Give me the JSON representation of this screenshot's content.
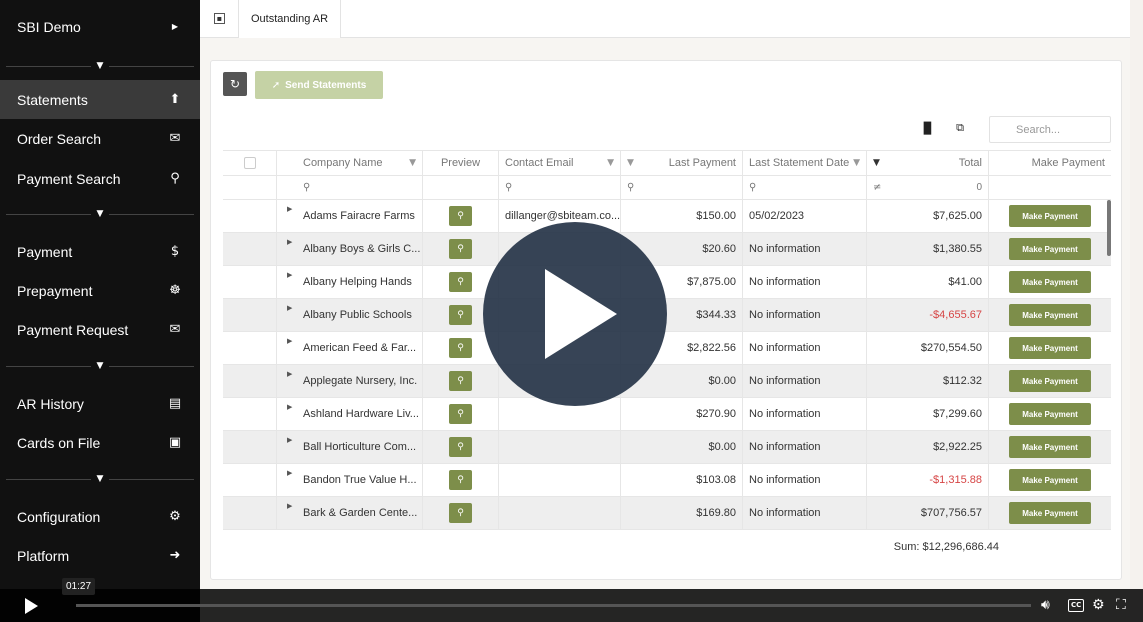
{
  "sidebar": {
    "title": "SBI Demo",
    "title_icon": "caret-right",
    "items": [
      {
        "label": "Statements",
        "icon": "upload-icon",
        "glyph": "⬆"
      },
      {
        "label": "Order Search",
        "icon": "envelope-open-icon",
        "glyph": "✉"
      },
      {
        "label": "Payment Search",
        "icon": "search-icon",
        "glyph": "⚲"
      },
      {
        "label": "Payment",
        "icon": "dollar-icon",
        "glyph": "$"
      },
      {
        "label": "Prepayment",
        "icon": "handshake-icon",
        "glyph": "☸"
      },
      {
        "label": "Payment Request",
        "icon": "envelope-icon",
        "glyph": "✉"
      },
      {
        "label": "AR History",
        "icon": "book-icon",
        "glyph": "▤"
      },
      {
        "label": "Cards on File",
        "icon": "file-icon",
        "glyph": "▣"
      },
      {
        "label": "Configuration",
        "icon": "cogs-icon",
        "glyph": "⚙"
      },
      {
        "label": "Platform",
        "icon": "sign-out-icon",
        "glyph": "➜"
      }
    ]
  },
  "topbar": {
    "tab_label": "Outstanding AR"
  },
  "toolbar": {
    "send_label": "Send Statements",
    "search_placeholder": "Search..."
  },
  "columns": {
    "company": "Company Name",
    "preview": "Preview",
    "email": "Contact Email",
    "last_payment": "Last Payment",
    "last_statement": "Last Statement Date",
    "total": "Total",
    "make_payment": "Make Payment"
  },
  "filter_row": {
    "total_value": "0"
  },
  "rows": [
    {
      "company": "Adams Fairacre Farms",
      "email": "dillanger@sbiteam.co...",
      "last_payment": "$150.00",
      "statement": "05/02/2023",
      "total": "$7,625.00",
      "neg": false
    },
    {
      "company": "Albany Boys & Girls C...",
      "email": "",
      "last_payment": "$20.60",
      "statement": "No information",
      "total": "$1,380.55",
      "neg": false
    },
    {
      "company": "Albany Helping Hands",
      "email": "",
      "last_payment": "$7,875.00",
      "statement": "No information",
      "total": "$41.00",
      "neg": false
    },
    {
      "company": "Albany Public Schools",
      "email": "",
      "last_payment": "$344.33",
      "statement": "No information",
      "total": "-$4,655.67",
      "neg": true
    },
    {
      "company": "American Feed & Far...",
      "email": "",
      "last_payment": "$2,822.56",
      "statement": "No information",
      "total": "$270,554.50",
      "neg": false
    },
    {
      "company": "Applegate Nursery, Inc.",
      "email": "",
      "last_payment": "$0.00",
      "statement": "No information",
      "total": "$112.32",
      "neg": false
    },
    {
      "company": "Ashland Hardware Liv...",
      "email": "",
      "last_payment": "$270.90",
      "statement": "No information",
      "total": "$7,299.60",
      "neg": false
    },
    {
      "company": "Ball Horticulture Com...",
      "email": "",
      "last_payment": "$0.00",
      "statement": "No information",
      "total": "$2,922.25",
      "neg": false
    },
    {
      "company": "Bandon True Value H...",
      "email": "",
      "last_payment": "$103.08",
      "statement": "No information",
      "total": "-$1,315.88",
      "neg": true
    },
    {
      "company": "Bark & Garden Cente...",
      "email": "",
      "last_payment": "$169.80",
      "statement": "No information",
      "total": "$707,756.57",
      "neg": false
    }
  ],
  "make_payment_label": "Make Payment",
  "sum_label": "Sum: $12,296,686.44",
  "video": {
    "time": "01:27",
    "progress": 0
  },
  "colors": {
    "accent_green": "#7d8e4a",
    "negative_red": "#d64545",
    "sidebar_bg": "#111111"
  }
}
